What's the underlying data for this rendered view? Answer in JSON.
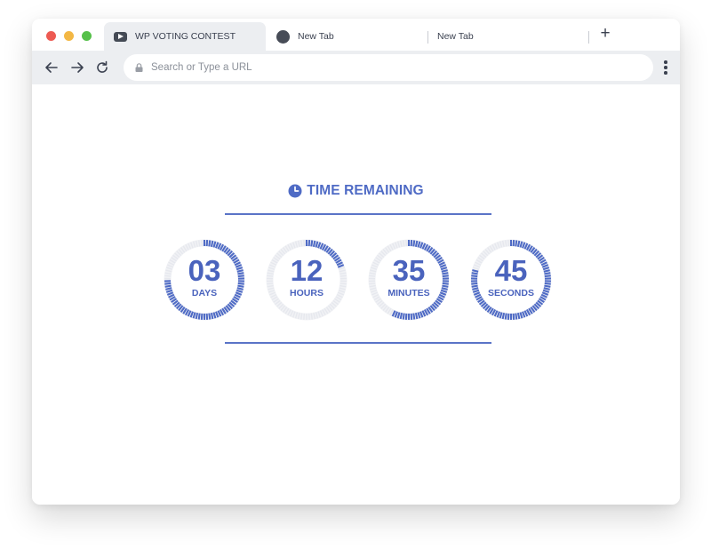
{
  "browser": {
    "tabs": [
      {
        "label": "WP VOTING CONTEST",
        "icon": "youtube-icon",
        "active": true
      },
      {
        "label": "New Tab",
        "icon": "globe-icon",
        "active": false
      },
      {
        "label": "New Tab",
        "icon": "",
        "active": false
      }
    ],
    "new_tab_label": "+",
    "address_bar": {
      "placeholder": "Search or Type a URL",
      "value": ""
    },
    "icons": [
      "back-arrow-icon",
      "forward-arrow-icon",
      "reload-icon",
      "lock-icon",
      "kebab-menu-icon"
    ]
  },
  "countdown": {
    "title": "TIME REMAINING",
    "title_icon": "clock-icon",
    "accent_color": "#4f6bc5",
    "units": [
      {
        "value": "03",
        "label": "DAYS",
        "progress": 0.75
      },
      {
        "value": "12",
        "label": "HOURS",
        "progress": 0.2
      },
      {
        "value": "35",
        "label": "MINUTES",
        "progress": 0.58
      },
      {
        "value": "45",
        "label": "SECONDS",
        "progress": 0.8
      }
    ]
  }
}
